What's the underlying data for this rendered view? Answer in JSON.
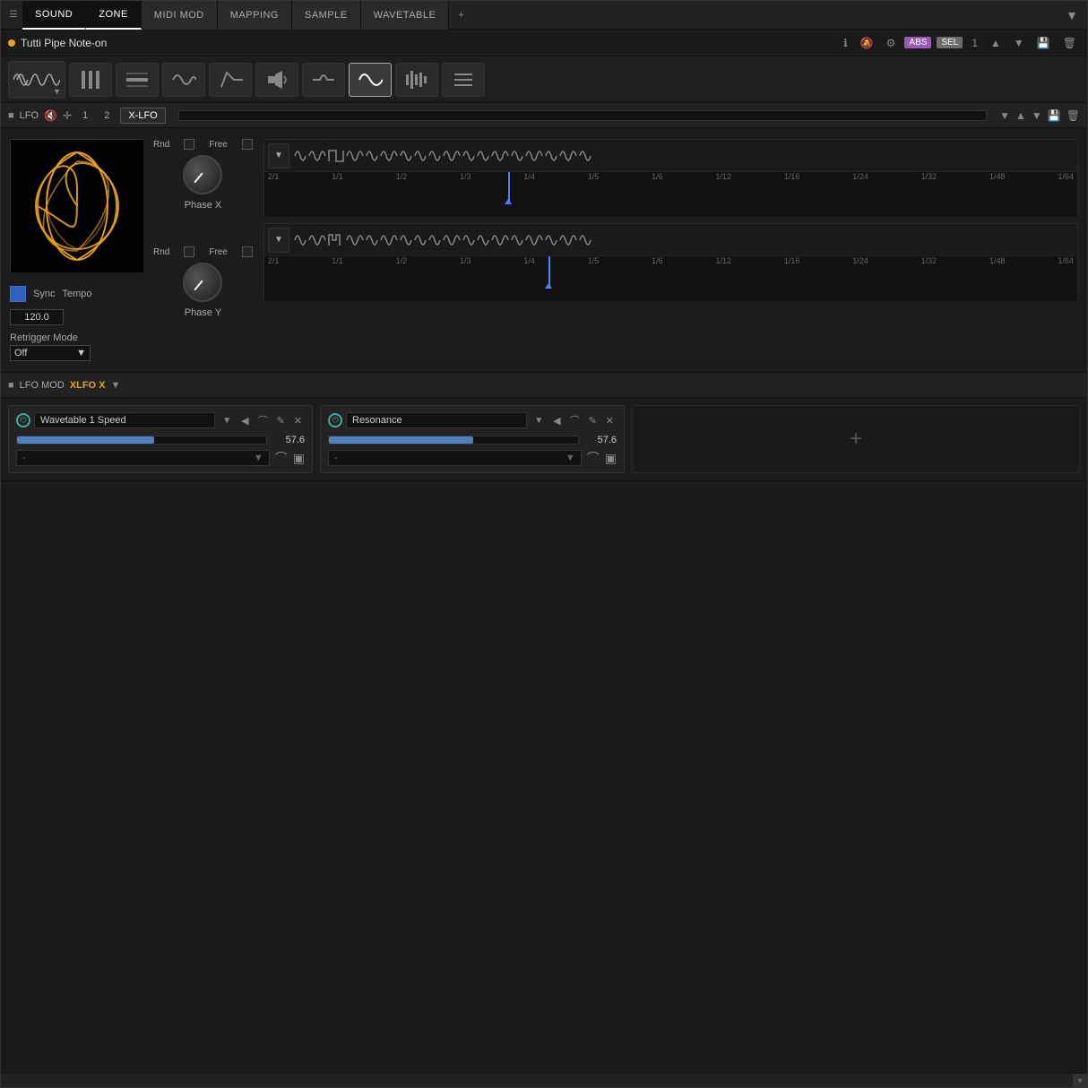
{
  "tabs": [
    {
      "label": "SOUND",
      "active": false
    },
    {
      "label": "ZONE",
      "active": true
    },
    {
      "label": "MIDI MOD",
      "active": false
    },
    {
      "label": "MAPPING",
      "active": false
    },
    {
      "label": "SAMPLE",
      "active": false
    },
    {
      "label": "WAVETABLE",
      "active": false
    }
  ],
  "header": {
    "title": "Tutti Pipe Note-on",
    "abs_label": "ABS",
    "sel_label": "SEL",
    "number": "1"
  },
  "lfo": {
    "label": "LFO",
    "tab1": "1",
    "tab2": "2",
    "xlfo_label": "X-LFO",
    "sync_label": "Sync",
    "tempo_label": "Tempo",
    "tempo_value": "120.0",
    "retrigger_label": "Retrigger Mode",
    "retrigger_value": "Off",
    "phase_x_label": "Phase X",
    "phase_y_label": "Phase Y",
    "rnd_label": "Rnd",
    "free_label": "Free",
    "rate_labels": [
      "2/1",
      "1/1",
      "1/2",
      "1/3",
      "1/4",
      "1/5",
      "1/6",
      "1/12",
      "1/16",
      "1/24",
      "1/32",
      "1/48",
      "1/64"
    ]
  },
  "lfo_mod": {
    "label": "LFO MOD",
    "source_label": "XLFO X",
    "mod1": {
      "name": "Wavetable 1 Speed",
      "value": "57.6",
      "fill_pct": 55,
      "source": "-"
    },
    "mod2": {
      "name": "Resonance",
      "value": "57.6",
      "fill_pct": 58,
      "source": "-"
    },
    "add_label": "+"
  },
  "waveform_toolbar": {
    "buttons": [
      "≈≈≈",
      "▐▌▐",
      "⊟",
      "≈≈≈",
      "⌒",
      "◀)",
      "⌒⌒",
      "∿",
      "▋▋▋▋",
      "≡≡"
    ]
  }
}
